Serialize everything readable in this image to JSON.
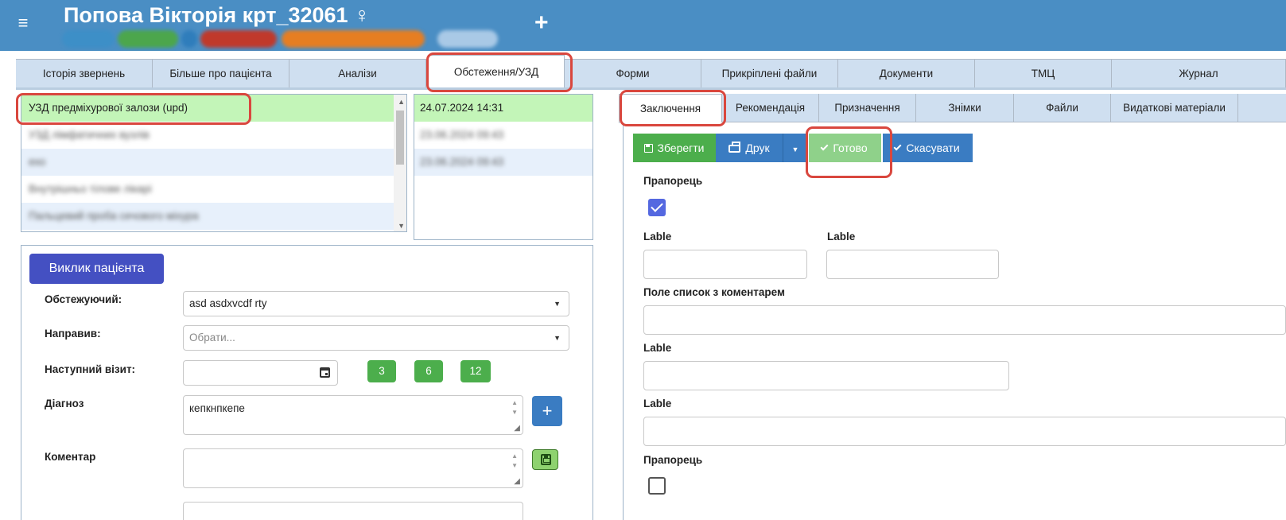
{
  "header": {
    "patient_name": "Попова Вікторія крт_32061 ♀",
    "menu_icon": "hamburger-icon",
    "add_icon": "plus-icon",
    "chips_colors": [
      "#3d8fc7",
      "#4ca64c",
      "#2f7dbb",
      "#c0392b",
      "#e67e22",
      "#a9c9e6"
    ]
  },
  "main_tabs": [
    {
      "label": "Історія звернень"
    },
    {
      "label": "Більше про пацієнта"
    },
    {
      "label": "Аналізи"
    },
    {
      "label": "Обстеження/УЗД"
    },
    {
      "label": "Форми"
    },
    {
      "label": "Прикріплені файли"
    },
    {
      "label": "Документи"
    },
    {
      "label": "ТМЦ"
    },
    {
      "label": "Журнал"
    }
  ],
  "exams_list": {
    "selected": "УЗД предміхурової залози (upd)"
  },
  "dates_list": {
    "selected": "24.07.2024 14:31"
  },
  "left_form": {
    "call_button": "Виклик пацієнта",
    "examiner_label": "Обстежуючий:",
    "examiner_value": "asd asdxvcdf rty",
    "referrer_label": "Направив:",
    "referrer_placeholder": "Обрати...",
    "next_visit_label": "Наступний візит:",
    "quick_buttons": [
      "3",
      "6",
      "12"
    ],
    "diagnosis_label": "Діагноз",
    "diagnosis_value": "кепкнпкепе",
    "comment_label": "Коментар"
  },
  "sub_tabs": [
    {
      "label": "Заключення"
    },
    {
      "label": "Рекомендація"
    },
    {
      "label": "Призначення"
    },
    {
      "label": "Знімки"
    },
    {
      "label": "Файли"
    },
    {
      "label": "Видаткові матеріали"
    }
  ],
  "toolbar": {
    "save": "Зберегти",
    "print": "Друк",
    "done": "Готово",
    "cancel": "Скасувати"
  },
  "right_form": {
    "flag1_label": "Прапорець",
    "flag1_checked": true,
    "lable_a": "Lable",
    "lable_b": "Lable",
    "list_comment_label": "Поле список з коментарем",
    "lable_c": "Lable",
    "lable_d": "Lable",
    "flag2_label": "Прапорець",
    "flag2_checked": false
  },
  "colors": {
    "header_bg": "#4a8ec4",
    "tab_bg": "#cfdff0",
    "selected_row": "#c3f5b8",
    "highlight": "#d9473e",
    "save_green": "#4cae4c",
    "print_blue": "#3a7cc2",
    "done_green_light": "#8fd18a",
    "call_button": "#4450c2"
  }
}
